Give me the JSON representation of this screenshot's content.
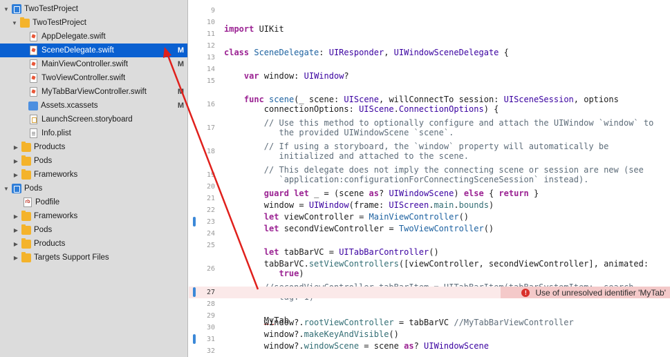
{
  "navigator": {
    "rows": [
      {
        "label": "TwoTestProject",
        "badge": "",
        "tri": "▼",
        "icon": "project-icon"
      },
      {
        "label": "TwoTestProject",
        "badge": "",
        "tri": "▼",
        "icon": "folder-icon"
      },
      {
        "label": "AppDelegate.swift",
        "badge": "",
        "tri": "",
        "icon": "swift-file-icon"
      },
      {
        "label": "SceneDelegate.swift",
        "badge": "M",
        "tri": "",
        "icon": "swift-file-icon",
        "selected": true
      },
      {
        "label": "MainViewController.swift",
        "badge": "M",
        "tri": "",
        "icon": "swift-file-icon"
      },
      {
        "label": "TwoViewController.swift",
        "badge": "",
        "tri": "",
        "icon": "swift-file-icon"
      },
      {
        "label": "MyTabBarViewController.swift",
        "badge": "M",
        "tri": "",
        "icon": "swift-file-icon"
      },
      {
        "label": "Assets.xcassets",
        "badge": "M",
        "tri": "",
        "icon": "assets-icon"
      },
      {
        "label": "LaunchScreen.storyboard",
        "badge": "",
        "tri": "",
        "icon": "storyboard-icon"
      },
      {
        "label": "Info.plist",
        "badge": "",
        "tri": "",
        "icon": "plist-icon"
      },
      {
        "label": "Products",
        "badge": "",
        "tri": "▶",
        "icon": "folder-icon"
      },
      {
        "label": "Pods",
        "badge": "",
        "tri": "▶",
        "icon": "folder-icon"
      },
      {
        "label": "Frameworks",
        "badge": "",
        "tri": "▶",
        "icon": "folder-icon"
      },
      {
        "label": "Pods",
        "badge": "",
        "tri": "▼",
        "icon": "project-icon"
      },
      {
        "label": "Podfile",
        "badge": "",
        "tri": "",
        "icon": "ruby-file-icon"
      },
      {
        "label": "Frameworks",
        "badge": "",
        "tri": "▶",
        "icon": "folder-icon"
      },
      {
        "label": "Pods",
        "badge": "",
        "tri": "▶",
        "icon": "folder-icon"
      },
      {
        "label": "Products",
        "badge": "",
        "tri": "▶",
        "icon": "folder-icon"
      },
      {
        "label": "Targets Support Files",
        "badge": "",
        "tri": "▶",
        "icon": "folder-icon"
      }
    ]
  },
  "editor": {
    "lines": [
      {
        "n": "9"
      },
      {
        "n": "10"
      },
      {
        "n": "11"
      },
      {
        "n": "12"
      },
      {
        "n": "13"
      },
      {
        "n": "14"
      },
      {
        "n": "15"
      },
      {
        "n": "16"
      },
      {
        "n": "17"
      },
      {
        "n": "18"
      },
      {
        "n": "19"
      },
      {
        "n": "20"
      },
      {
        "n": "21"
      },
      {
        "n": "22"
      },
      {
        "n": "23"
      },
      {
        "n": "24"
      },
      {
        "n": "25"
      },
      {
        "n": "26"
      },
      {
        "n": "27"
      },
      {
        "n": "28"
      },
      {
        "n": "29"
      },
      {
        "n": "30"
      },
      {
        "n": "31"
      },
      {
        "n": "32"
      }
    ],
    "error_message": "Use of unresolved identifier 'MyTab'",
    "error_icon": "!"
  },
  "colors": {
    "selection": "#0a60d1",
    "annotation_arrow": "#e0201c",
    "error_banner": "#f4c9c9",
    "change_marker": "#3b88d8"
  }
}
